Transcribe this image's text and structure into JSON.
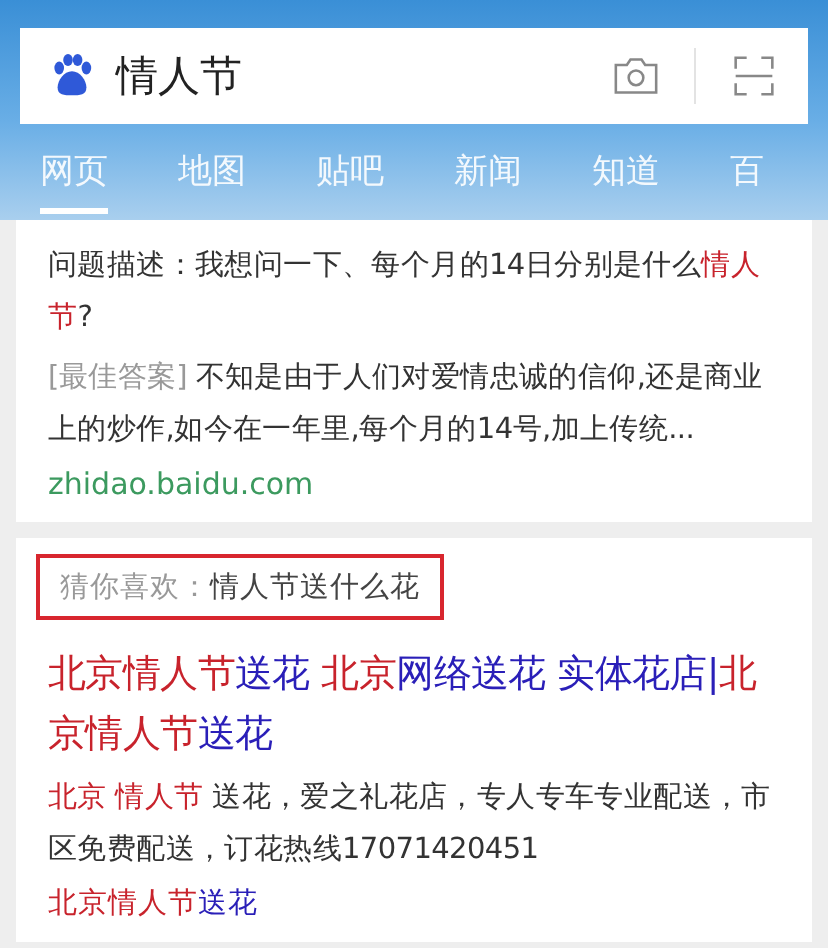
{
  "search": {
    "value": "情人节"
  },
  "tabs": [
    {
      "label": "网页",
      "selected": true
    },
    {
      "label": "地图",
      "selected": false
    },
    {
      "label": "贴吧",
      "selected": false
    },
    {
      "label": "新闻",
      "selected": false
    },
    {
      "label": "知道",
      "selected": false
    },
    {
      "label": "百",
      "selected": false
    }
  ],
  "answer_card": {
    "question": [
      {
        "text": "问题描述：我想问一下、每个月的14日分别是什么",
        "highlight": false
      },
      {
        "text": "情人节",
        "highlight": true
      },
      {
        "text": "?",
        "highlight": false
      }
    ],
    "best_label": "[最佳答案]",
    "best_text": "不知是由于人们对爱情忠诚的信仰,还是商业上的炒作,如今在一年里,每个月的14号,加上传统...",
    "source": "zhidao.baidu.com"
  },
  "guess": {
    "label": "猜你喜欢：",
    "query": "情人节送什么花"
  },
  "ad": {
    "title": [
      {
        "text": "北京情人节",
        "highlight": true
      },
      {
        "text": "送花 ",
        "highlight": false
      },
      {
        "text": "北京",
        "highlight": true
      },
      {
        "text": "网络送花 实体花店|",
        "highlight": false
      },
      {
        "text": "北京情人节",
        "highlight": true
      },
      {
        "text": "送花",
        "highlight": false
      }
    ],
    "desc": [
      {
        "text": "北京 情人节",
        "highlight": true
      },
      {
        "text": " 送花，爱之礼花店，专人专车专业配送，市区免费配送，订花热线17071420451",
        "highlight": false
      }
    ],
    "link": [
      {
        "text": "北京情人节",
        "highlight": true
      },
      {
        "text": "送花",
        "highlight": false
      }
    ]
  }
}
